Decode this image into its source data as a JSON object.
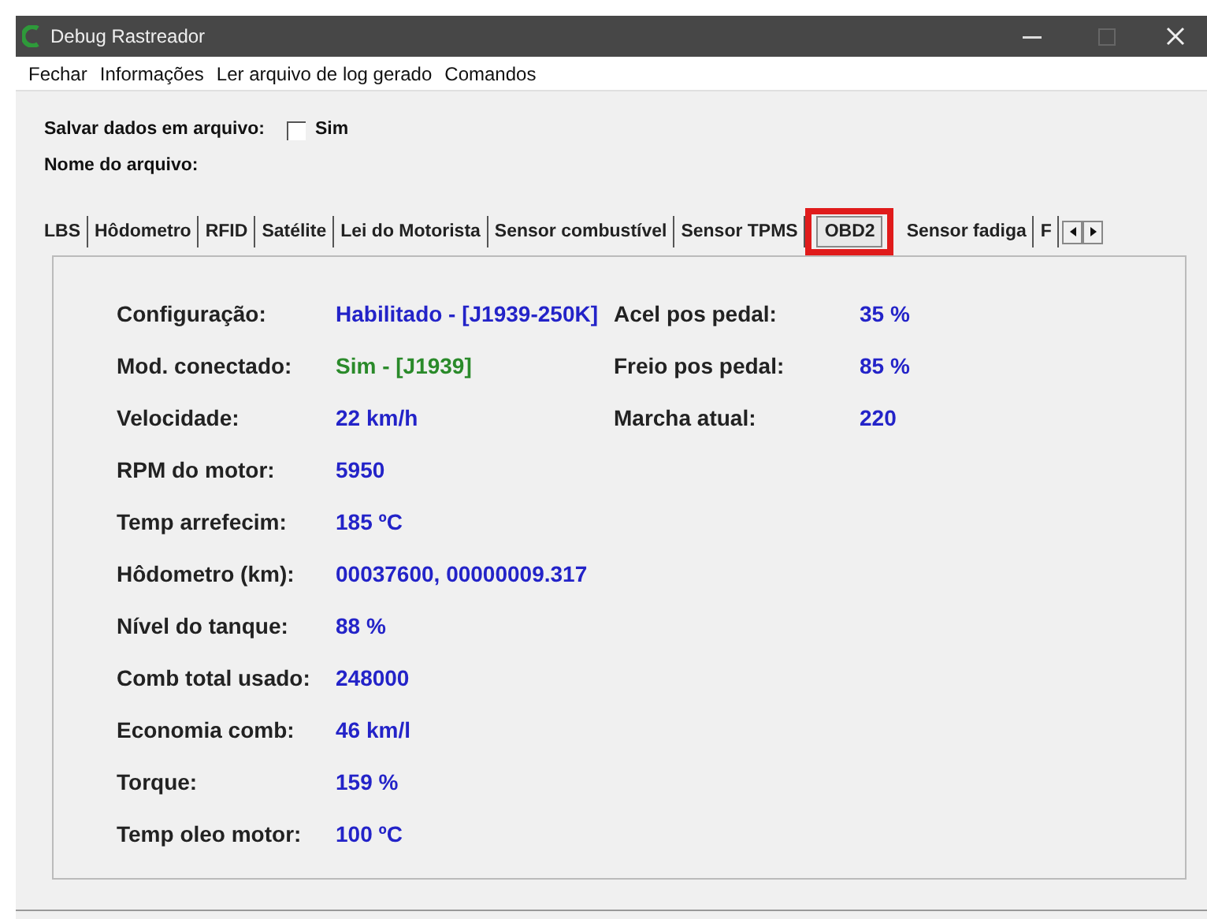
{
  "window": {
    "title": "Debug Rastreador"
  },
  "menu": [
    "Fechar",
    "Informações",
    "Ler arquivo de log gerado",
    "Comandos"
  ],
  "save": {
    "label": "Salvar dados em arquivo:",
    "checkbox_label": "Sim",
    "checked": false
  },
  "file_name": {
    "label": "Nome do arquivo:"
  },
  "tabs": [
    {
      "label": "LBS",
      "selected": false,
      "highlighted": false
    },
    {
      "label": "Hôdometro",
      "selected": false,
      "highlighted": false
    },
    {
      "label": "RFID",
      "selected": false,
      "highlighted": false
    },
    {
      "label": "Satélite",
      "selected": false,
      "highlighted": false
    },
    {
      "label": "Lei do Motorista",
      "selected": false,
      "highlighted": false
    },
    {
      "label": "Sensor combustível",
      "selected": false,
      "highlighted": false
    },
    {
      "label": "Sensor TPMS",
      "selected": false,
      "highlighted": false
    },
    {
      "label": "OBD2",
      "selected": true,
      "highlighted": true
    },
    {
      "label": "Sensor fadiga",
      "selected": false,
      "highlighted": false
    },
    {
      "label": "F",
      "selected": false,
      "highlighted": false
    }
  ],
  "left_fields": [
    {
      "label": "Configuração:",
      "value": "Habilitado - [J1939-250K]",
      "color": "#2323c8"
    },
    {
      "label": "Mod. conectado:",
      "value": "Sim - [J1939]",
      "color": "#2a8a2a"
    },
    {
      "label": "Velocidade:",
      "value": "22 km/h",
      "color": "#2323c8"
    },
    {
      "label": "RPM do motor:",
      "value": "5950",
      "color": "#2323c8"
    },
    {
      "label": "Temp arrefecim:",
      "value": "185 ºC",
      "color": "#2323c8"
    },
    {
      "label": "Hôdometro (km):",
      "value": "00037600, 00000009.317",
      "color": "#2323c8"
    },
    {
      "label": "Nível do tanque:",
      "value": "88 %",
      "color": "#2323c8"
    },
    {
      "label": "Comb total usado:",
      "value": "248000",
      "color": "#2323c8"
    },
    {
      "label": "Economia comb:",
      "value": "46 km/l",
      "color": "#2323c8"
    },
    {
      "label": "Torque:",
      "value": "159 %",
      "color": "#2323c8"
    },
    {
      "label": "Temp oleo motor:",
      "value": "100 ºC",
      "color": "#2323c8"
    }
  ],
  "right_fields": [
    {
      "label": "Acel pos pedal:",
      "value": "35 %",
      "color": "#2323c8"
    },
    {
      "label": "Freio pos pedal:",
      "value": "85 %",
      "color": "#2323c8"
    },
    {
      "label": "Marcha atual:",
      "value": "220",
      "color": "#2323c8"
    }
  ]
}
